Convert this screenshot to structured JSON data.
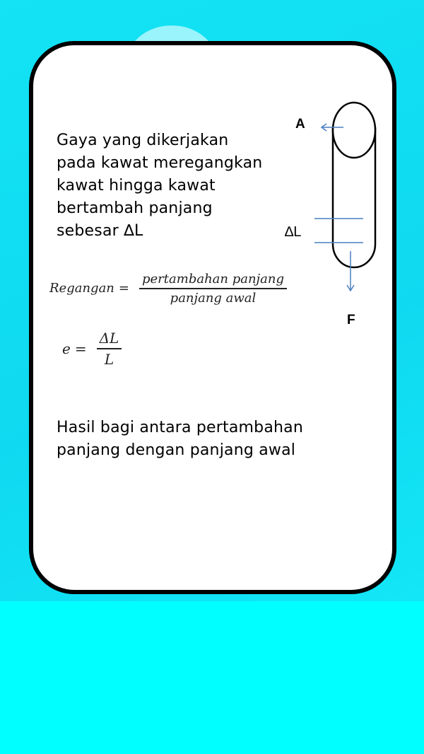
{
  "slide": {
    "paragraph_1": [
      "Gaya yang dikerjakan",
      "pada kawat meregangkan",
      "kawat hingga kawat",
      "bertambah panjang",
      "sebesar ∆L"
    ],
    "formula_strain": {
      "lhs": "Regangan",
      "equals": "=",
      "numerator": "pertambahan panjang",
      "denominator": "panjang awal"
    },
    "formula_e": {
      "lhs": "e",
      "equals": "=",
      "numerator": "ΔL",
      "denominator": "L"
    },
    "paragraph_2": [
      "Hasil bagi antara pertambahan",
      "panjang dengan panjang awal"
    ]
  },
  "diagram": {
    "label_a": "A",
    "label_delta_l": "∆L",
    "label_f": "F",
    "arrow_color": "#4a7fc0",
    "outline_color": "#000000"
  },
  "colors": {
    "background_top": "#13e3f4",
    "background_bottom": "#00ffff",
    "card": "#ffffff",
    "card_border": "#000000"
  }
}
